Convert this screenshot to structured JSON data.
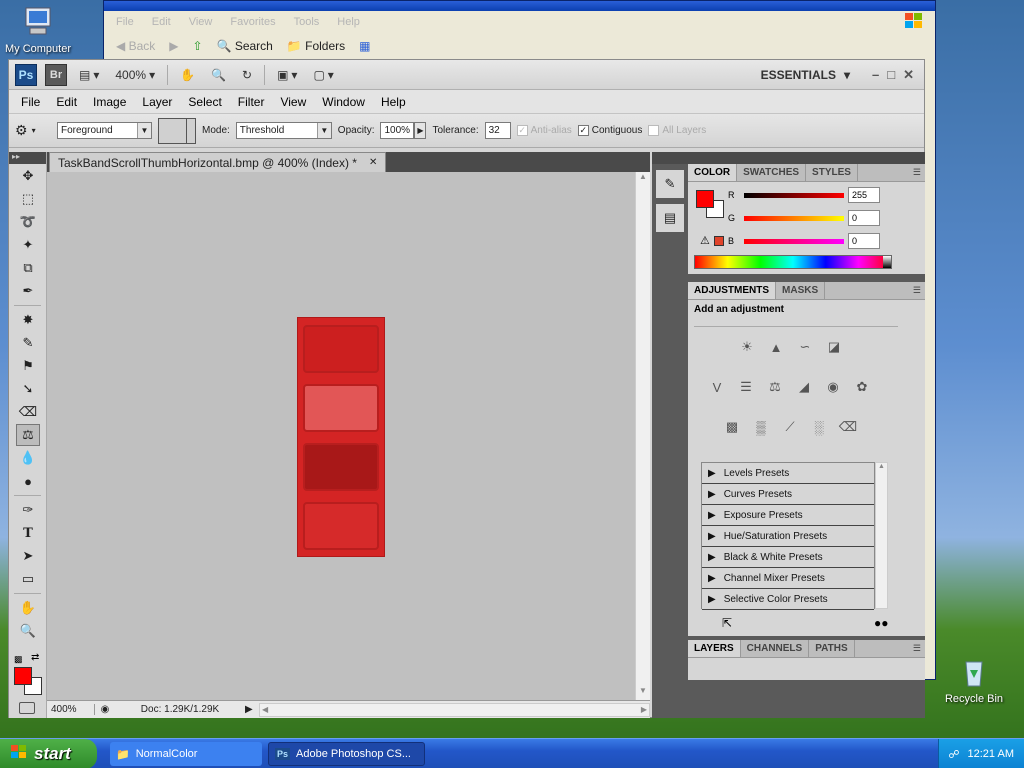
{
  "desktop": {
    "my_computer": "My Computer",
    "recycle_bin": "Recycle Bin"
  },
  "explorer": {
    "menu": [
      "File",
      "Edit",
      "View",
      "Favorites",
      "Tools",
      "Help"
    ],
    "back": "Back",
    "search": "Search",
    "folders": "Folders"
  },
  "appbar": {
    "ps": "Ps",
    "br": "Br",
    "zoom": "400%",
    "workspace": "ESSENTIALS"
  },
  "menubar": [
    "File",
    "Edit",
    "Image",
    "Layer",
    "Select",
    "Filter",
    "View",
    "Window",
    "Help"
  ],
  "options": {
    "fill_source": "Foreground",
    "mode_label": "Mode:",
    "mode": "Threshold",
    "opacity_label": "Opacity:",
    "opacity": "100%",
    "tolerance_label": "Tolerance:",
    "tolerance": "32",
    "anti_alias": "Anti-alias",
    "contiguous": "Contiguous",
    "all_layers": "All Layers"
  },
  "document": {
    "tab_title": "TaskBandScrollThumbHorizontal.bmp @ 400% (Index) *",
    "status_zoom": "400%",
    "doc_size": "Doc: 1.29K/1.29K"
  },
  "color_panel": {
    "tabs": [
      "COLOR",
      "SWATCHES",
      "STYLES"
    ],
    "r_label": "R",
    "g_label": "G",
    "b_label": "B",
    "r": "255",
    "g": "0",
    "b": "0",
    "foreground_color": "#ff0000"
  },
  "adjustments_panel": {
    "tabs": [
      "ADJUSTMENTS",
      "MASKS"
    ],
    "heading": "Add an adjustment",
    "presets": [
      "Levels Presets",
      "Curves Presets",
      "Exposure Presets",
      "Hue/Saturation Presets",
      "Black & White Presets",
      "Channel Mixer Presets",
      "Selective Color Presets"
    ]
  },
  "layers_panel": {
    "tabs": [
      "LAYERS",
      "CHANNELS",
      "PATHS"
    ]
  },
  "taskbar": {
    "start": "start",
    "tasks": [
      "NormalColor",
      "Adobe Photoshop CS..."
    ],
    "clock": "12:21 AM"
  }
}
